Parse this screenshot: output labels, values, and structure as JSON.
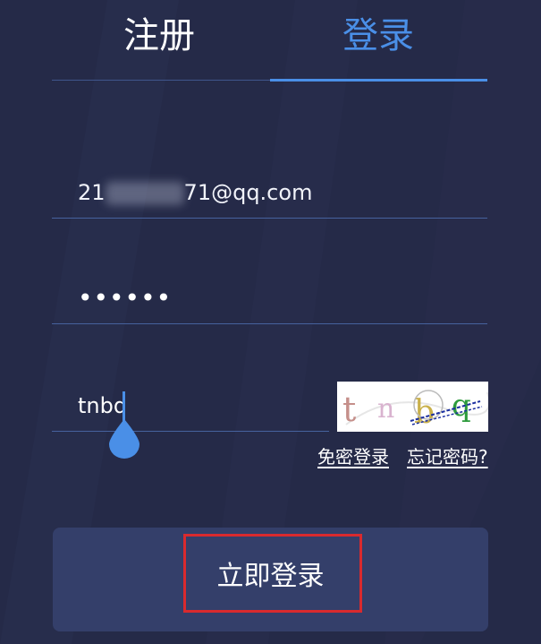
{
  "tabs": [
    {
      "label": "注册",
      "active": false
    },
    {
      "label": "登录",
      "active": true
    }
  ],
  "form": {
    "email_prefix": "21",
    "email_suffix": "71@qq.com",
    "password_value": "••••••",
    "captcha_value": "tnbq",
    "captcha_image_text": "tnbq"
  },
  "links": {
    "password_free_login": "免密登录",
    "forgot_password": "忘记密码?"
  },
  "submit": {
    "label": "立即登录"
  },
  "colors": {
    "background": "#252a48",
    "accent": "#4a8fe7",
    "button": "#343f6a",
    "highlight": "#d92a2e"
  }
}
